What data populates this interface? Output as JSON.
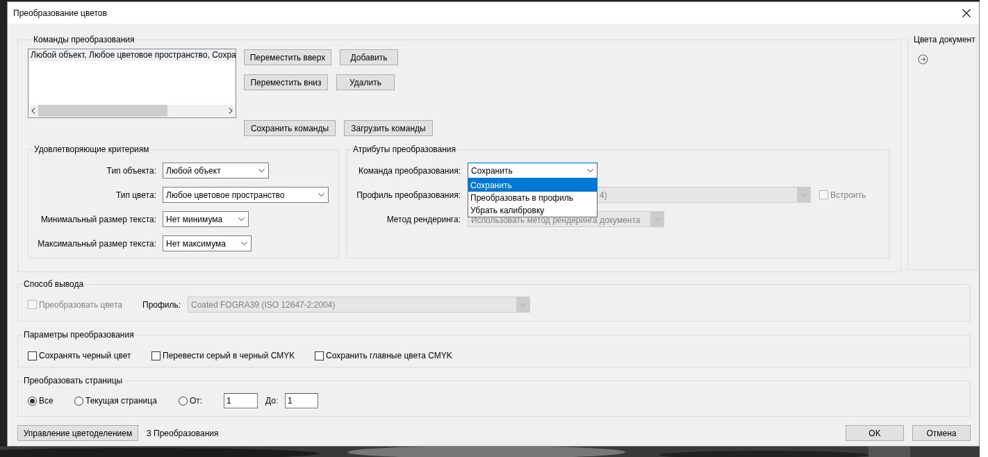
{
  "window": {
    "title": "Преобразование цветов"
  },
  "commands": {
    "title": "Команды преобразования",
    "list_items": [
      {
        "text": "Любой объект, Любое цветовое пространство, Сохра",
        "selected": true
      }
    ],
    "buttons": [
      "Переместить вверх",
      "Добавить",
      "Переместить вниз",
      "Удалить",
      "Сохранить команды",
      "Загрузить команды"
    ]
  },
  "criteria": {
    "title": "Удовлетворяющие критериям",
    "rows": [
      {
        "label": "Тип объекта:",
        "value": "Любой объект"
      },
      {
        "label": "Тип цвета:",
        "value": "Любое цветовое пространство"
      },
      {
        "label": "Минимальный размер текста:",
        "value": "Нет минимума"
      },
      {
        "label": "Максимальный размер текста:",
        "value": "Нет максимума"
      }
    ]
  },
  "attributes": {
    "title": "Атрибуты преобразования",
    "rows": [
      {
        "label": "Команда преобразования:",
        "value": "Сохранить",
        "disabled": false,
        "focused": true
      },
      {
        "label": "Профиль преобразования:",
        "value": "4)",
        "disabled": true,
        "focused": false
      },
      {
        "label": "Метод рендеринга:",
        "value": "Использовать метод рендеринга документа",
        "disabled": true,
        "focused": false
      }
    ],
    "embed": {
      "label": "Встроить",
      "checked": false,
      "disabled": true
    },
    "dropdown_menu": [
      {
        "label": "Сохранить",
        "selected": true
      },
      {
        "label": "Преобразовать в профиль",
        "selected": false
      },
      {
        "label": "Убрать калибровку",
        "selected": false
      }
    ]
  },
  "document_colors": {
    "title": "Цвета документ"
  },
  "output": {
    "title": "Способ вывода",
    "convert": {
      "label": "Преобразовать цвета",
      "checked": false,
      "disabled": true
    },
    "profile_label": "Профиль:",
    "profile_value": "Coated FOGRA39 (ISO 12647-2:2004)",
    "profile_disabled": true
  },
  "options": {
    "title": "Параметры преобразования",
    "checkboxes": [
      {
        "label": "Сохранять черный цвет",
        "checked": false
      },
      {
        "label": "Перевести серый в черный CMYK",
        "checked": false
      },
      {
        "label": "Сохранить главные цвета CMYK",
        "checked": false
      }
    ]
  },
  "pages": {
    "title": "Преобразовать страницы",
    "radios": [
      {
        "label": "Все",
        "selected": true
      },
      {
        "label": "Текущая страница",
        "selected": false
      },
      {
        "label": "От:",
        "selected": false
      }
    ],
    "from": "1",
    "to_label": "До:",
    "to": "1"
  },
  "footer": {
    "separations_button": "Управление цветоделением",
    "count": "3 Преобразования",
    "ok": "OK",
    "cancel": "Отмена"
  }
}
